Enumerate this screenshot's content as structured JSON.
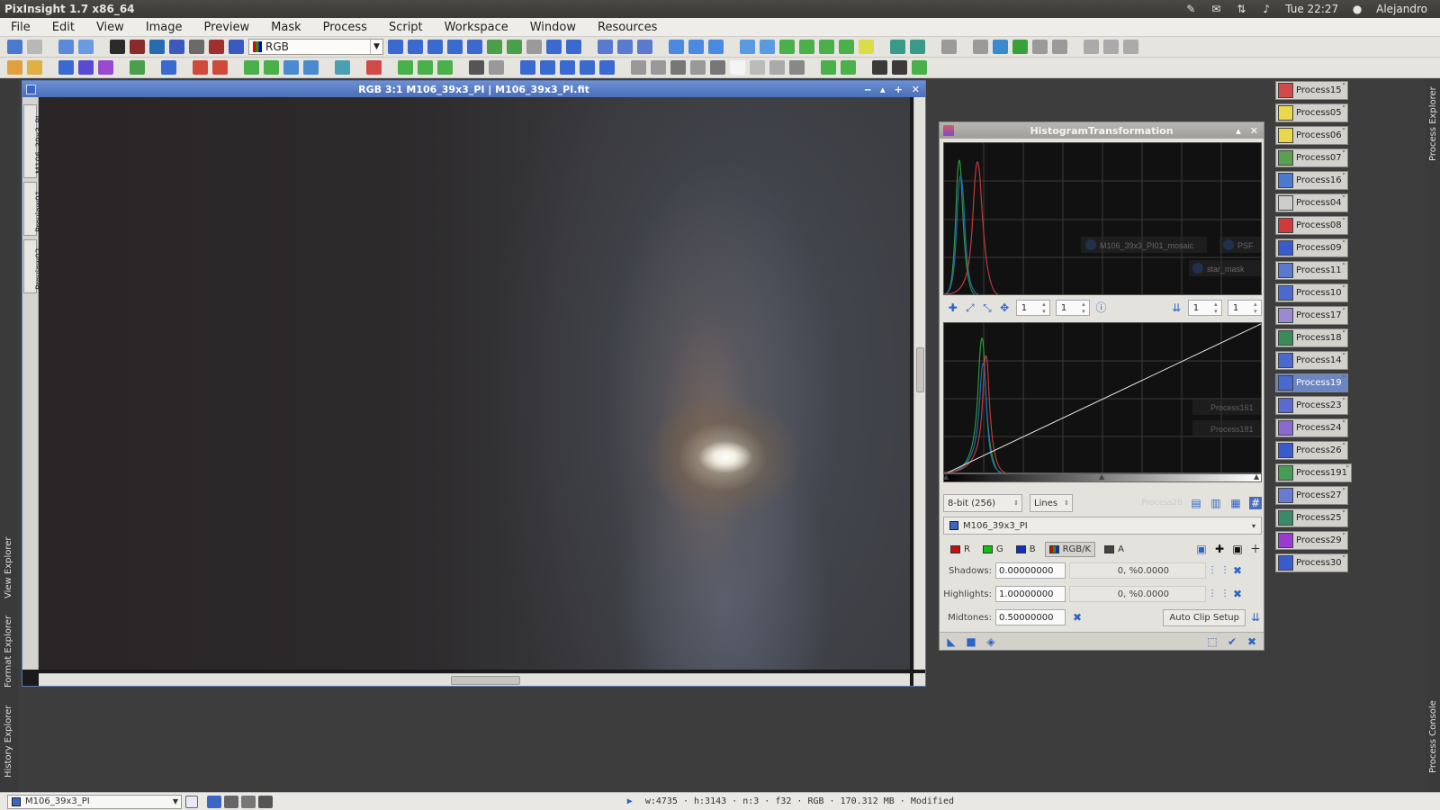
{
  "os": {
    "app_title": "PixInsight 1.7 x86_64",
    "clock": "Tue 22:27",
    "user": "Alejandro"
  },
  "menu": [
    "File",
    "Edit",
    "View",
    "Image",
    "Preview",
    "Mask",
    "Process",
    "Script",
    "Workspace",
    "Window",
    "Resources"
  ],
  "toolbar": {
    "color_space": "RGB"
  },
  "left_panel_tabs": [
    "View Explorer",
    "Format Explorer",
    "History Explorer"
  ],
  "right_panel_tabs": [
    "Process Explorer",
    "Process Console"
  ],
  "image_window": {
    "title": "RGB 3:1 M106_39x3_PI | M106_39x3_PI.fit",
    "tabs": [
      "M106_39x3_PI",
      "Preview01",
      "Preview02"
    ]
  },
  "histogram": {
    "title": "HistogramTransformation",
    "zoom_h": "1",
    "zoom_v": "1",
    "zoom_h2": "1",
    "zoom_v2": "1",
    "resolution": "8-bit (256)",
    "graph_style": "Lines",
    "view": "M106_39x3_PI",
    "channels": [
      "R",
      "G",
      "B",
      "RGB/K",
      "A"
    ],
    "shadows_label": "Shadows:",
    "shadows": "0.00000000",
    "shadows_clip": "0, %0.0000",
    "highlights_label": "Highlights:",
    "highlights": "1.00000000",
    "highlights_clip": "0, %0.0000",
    "midtones_label": "Midtones:",
    "midtones": "0.50000000",
    "auto_clip": "Auto Clip Setup",
    "ghost_labels": [
      "M106_39x3_PI01_mosaic",
      "PSF",
      "star_mask",
      "Process161",
      "Process181",
      "Process28"
    ]
  },
  "process_icons": [
    {
      "name": "Process15",
      "color": "#d04a4a"
    },
    {
      "name": "Process05",
      "color": "#e8d84a"
    },
    {
      "name": "Process06",
      "color": "#e8d84a"
    },
    {
      "name": "Process07",
      "color": "#5aa050"
    },
    {
      "name": "Process16",
      "color": "#4a7ad0"
    },
    {
      "name": "Process04",
      "color": "#cccccc"
    },
    {
      "name": "Process08",
      "color": "#d03a3a"
    },
    {
      "name": "Process09",
      "color": "#3a5ad0"
    },
    {
      "name": "Process11",
      "color": "#5a7ad0"
    },
    {
      "name": "Process10",
      "color": "#4a6ad0"
    },
    {
      "name": "Process17",
      "color": "#9a8ad0"
    },
    {
      "name": "Process18",
      "color": "#3a8a5a"
    },
    {
      "name": "Process14",
      "color": "#4a6ad0"
    },
    {
      "name": "Process19",
      "color": "#4a6ad0"
    },
    {
      "name": "Process23",
      "color": "#5a6ad0"
    },
    {
      "name": "Process24",
      "color": "#8a6ad0"
    },
    {
      "name": "Process26",
      "color": "#3a5ad0"
    },
    {
      "name": "Process191",
      "color": "#4a9a5a"
    },
    {
      "name": "Process27",
      "color": "#6a7ad0"
    },
    {
      "name": "Process25",
      "color": "#3a8a6a"
    },
    {
      "name": "Process29",
      "color": "#9a3ad0"
    },
    {
      "name": "Process30",
      "color": "#3a5ad0"
    }
  ],
  "status": {
    "view": "M106_39x3_PI",
    "info": "w:4735 · h:3143 · n:3 · f32 · RGB · 170.312 MB · Modified"
  }
}
